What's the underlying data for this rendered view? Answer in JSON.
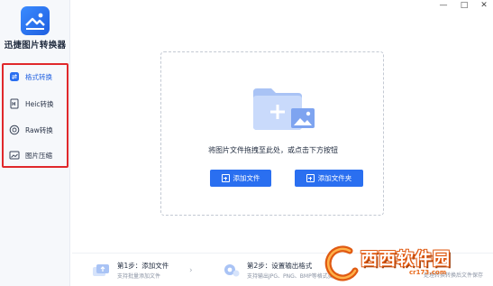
{
  "app": {
    "title": "迅捷图片转换器"
  },
  "window": {
    "minimize": "—",
    "maximize": "□",
    "close": "✕"
  },
  "sidebar": {
    "items": [
      {
        "label": "格式转换",
        "icon": "format-convert-icon",
        "active": true
      },
      {
        "label": "Heic转换",
        "icon": "heic-icon",
        "active": false
      },
      {
        "label": "Raw转换",
        "icon": "raw-camera-icon",
        "active": false
      },
      {
        "label": "图片压缩",
        "icon": "image-compress-icon",
        "active": false
      }
    ]
  },
  "main": {
    "drop_hint": "将图片文件拖拽至此处，或点击下方按钮",
    "add_file_label": "添加文件",
    "add_folder_label": "添加文件夹"
  },
  "steps": [
    {
      "title": "第1步：添加文件",
      "desc": "支持批量添加文件"
    },
    {
      "title": "第2步：设置输出格式",
      "desc": "支持输出JPG、PNG、BMP等格式类型"
    },
    {
      "title": "",
      "desc": "处理转换转换后文件保存"
    }
  ],
  "watermark": {
    "brand": "西西软件园",
    "url": "cr173.com"
  },
  "colors": {
    "accent": "#2a6ff0",
    "highlight_border": "#e0282b",
    "watermark": "#e05a12"
  }
}
